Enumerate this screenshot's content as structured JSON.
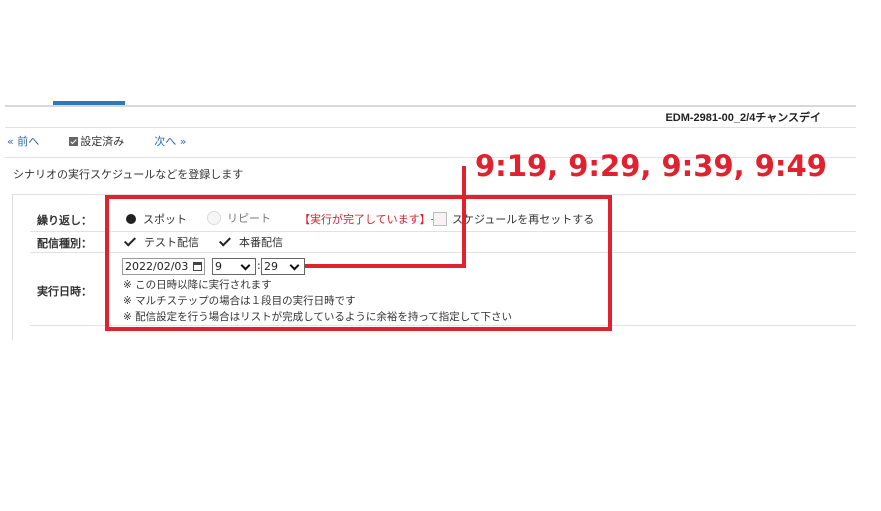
{
  "header": {
    "scenario_name": "EDM-2981-00_2/4チャンスデイ"
  },
  "nav": {
    "prev_label": "« 前へ",
    "configured_label": "設定済み",
    "next_label": "次へ »"
  },
  "description": "シナリオの実行スケジュールなどを登録します",
  "form": {
    "repeat": {
      "label": "繰り返し：",
      "option_spot": "スポット",
      "option_repeat": "リピート",
      "selected": "スポット",
      "done_message": "【実行が完了しています】→",
      "reset_label": "スケジュールを再セットする"
    },
    "delivery_type": {
      "label": "配信種別：",
      "test_label": "テスト配信",
      "test_checked": true,
      "live_label": "本番配信",
      "live_checked": true
    },
    "exec_datetime": {
      "label": "実行日時：",
      "date_value": "2022/02/03",
      "hour_value": "9",
      "separator": ":",
      "minute_value": "29",
      "notes": [
        "※ この日時以降に実行されます",
        "※ マルチステップの場合は１段目の実行日時です",
        "※ 配信設定を行う場合はリストが完成しているように余裕を持って指定して下さい"
      ]
    }
  },
  "annotation": {
    "text": "9:19, 9:29, 9:39, 9:49",
    "color": "#e0212e"
  },
  "colors": {
    "accent": "#2a7ac0",
    "link": "#2a6fb7",
    "warning": "#d3232d"
  }
}
